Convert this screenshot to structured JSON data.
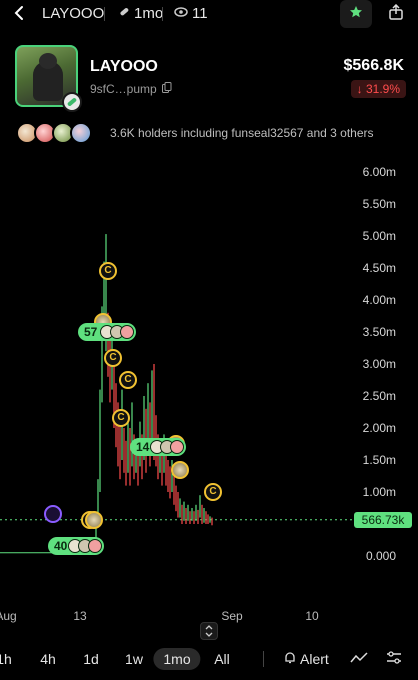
{
  "header": {
    "title": "LAYOOO",
    "age": "1mo",
    "watchers": "11",
    "icons": [
      "back-chevron-icon",
      "pill-icon",
      "eye-icon",
      "star-icon",
      "share-icon"
    ]
  },
  "token": {
    "name": "LAYOOO",
    "address": "9sfC…pump",
    "price": "$566.8K",
    "change": "↓ 31.9%",
    "change_color": "#ff4d4d",
    "accent": "#4ad27a"
  },
  "holders": {
    "text": "3.6K holders including funseal32567 and 3 others"
  },
  "chart_data": {
    "type": "candlestick",
    "y_ticks": [
      "6.00m",
      "5.50m",
      "5.00m",
      "4.50m",
      "4.00m",
      "3.50m",
      "3.00m",
      "2.50m",
      "2.00m",
      "1.50m",
      "1.00m",
      "0.000"
    ],
    "x_ticks": [
      "Aug",
      "13",
      "Sep",
      "10"
    ],
    "ylim": [
      -0.8,
      6.0
    ],
    "current_price_label": "566.73k",
    "current_price": 0.567,
    "up_color": "#5fe07f",
    "down_color": "#ff4d4d",
    "bubbles": [
      {
        "label": "57",
        "value": 3.5
      },
      {
        "label": "14",
        "value": 1.7
      },
      {
        "label": "40",
        "value": 0.15
      }
    ],
    "markers": [
      {
        "label": "C",
        "value": 4.45
      },
      {
        "label": "C",
        "value": 3.1
      },
      {
        "label": "C",
        "value": 2.75
      },
      {
        "label": "C",
        "value": 2.15
      },
      {
        "label": "C",
        "value": 1.0
      },
      {
        "label": "C",
        "value": 0.57
      }
    ]
  },
  "timeframes": [
    "1h",
    "4h",
    "1d",
    "1w",
    "1mo",
    "All"
  ],
  "active_timeframe": "1mo",
  "bottom": {
    "alert_label": "Alert"
  }
}
